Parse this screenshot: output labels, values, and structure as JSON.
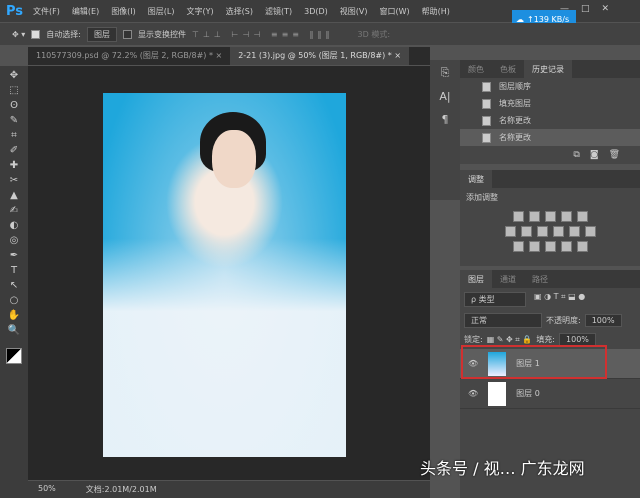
{
  "app": {
    "logo": "Ps",
    "menus": [
      "文件(F)",
      "编辑(E)",
      "图像(I)",
      "图层(L)",
      "文字(Y)",
      "选择(S)",
      "滤镜(T)",
      "3D(D)",
      "视图(V)",
      "窗口(W)",
      "帮助(H)"
    ],
    "net_speed": "↑139 KB/s",
    "win": [
      "—",
      "□",
      "✕"
    ]
  },
  "options": {
    "auto_select": "自动选择:",
    "target": "图层",
    "show_transform": "显示变换控件",
    "mode3d": "3D 模式:"
  },
  "doc_tabs": [
    {
      "label": "110577309.psd @ 72.2% (图层 2, RGB/8#) * ×"
    },
    {
      "label": "2-21 (3).jpg @ 50% (图层 1, RGB/8#) * ×"
    }
  ],
  "tools": [
    "✥",
    "⬚",
    "ʘ",
    "✎",
    "⌗",
    "✐",
    "✚",
    "✂",
    "▲",
    "✍",
    "◐",
    "◎",
    "✒",
    "T",
    "↖",
    "○",
    "✋",
    "🔍"
  ],
  "status": {
    "zoom": "50%",
    "doc": "文档:2.01M/2.01M"
  },
  "history_panel": {
    "tabs": [
      "颜色",
      "色板",
      "历史记录"
    ],
    "items": [
      "图层顺序",
      "填充图层",
      "名称更改",
      "名称更改"
    ]
  },
  "adjust_panel": {
    "tab": "调整",
    "title": "添加调整"
  },
  "layers_panel": {
    "tabs": [
      "图层",
      "通道",
      "路径"
    ],
    "filter": "ρ 类型",
    "blend": "正常",
    "opacity_label": "不透明度:",
    "opacity": "100%",
    "lock_label": "锁定:",
    "fill_label": "填充:",
    "fill": "100%",
    "layers": [
      {
        "name": "图层 1"
      },
      {
        "name": "图层 0"
      }
    ]
  },
  "watermark": "头条号 / 视… 广东龙网"
}
